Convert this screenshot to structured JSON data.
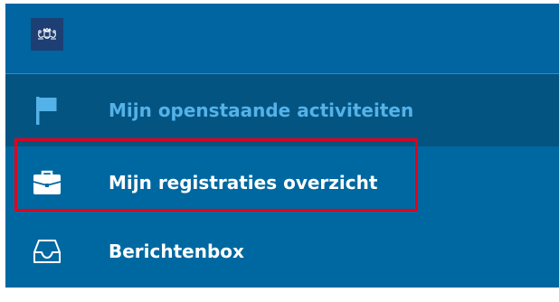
{
  "nav": {
    "logo_icon": "royal-coat-of-arms-icon",
    "items": [
      {
        "label": "Mijn openstaande activiteiten",
        "icon": "flag-icon",
        "active": true
      },
      {
        "label": "Mijn registraties overzicht",
        "icon": "briefcase-icon",
        "active": false,
        "highlighted": true
      },
      {
        "label": "Berichtenbox",
        "icon": "inbox-tray-icon",
        "active": false
      }
    ]
  },
  "colors": {
    "nav_background": "#0068a0",
    "active_background": "#035481",
    "active_text": "#54b2e8",
    "text": "#ffffff",
    "highlight_border": "#e3001b"
  }
}
